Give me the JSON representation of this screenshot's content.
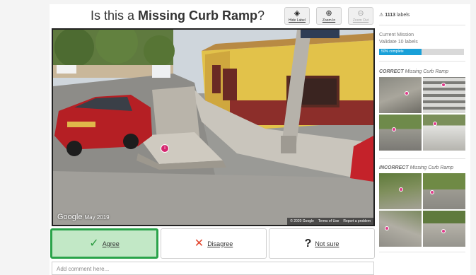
{
  "header": {
    "question_prefix": "Is this a ",
    "question_label": "Missing Curb Ramp",
    "question_suffix": "?"
  },
  "toolbar": {
    "hide_label": "Hide Label",
    "zoom_in": "Zoom In",
    "zoom_out": "Zoom Out"
  },
  "streetview": {
    "brand": "Google",
    "date": "May 2019",
    "copyright": "© 2020 Google",
    "terms": "Terms of Use",
    "report": "Report a problem",
    "sign_text": "AMBELES"
  },
  "votes": {
    "agree": "Agree",
    "disagree": "Disagree",
    "not_sure": "Not sure"
  },
  "comment": {
    "placeholder": "Add comment here..."
  },
  "sidebar": {
    "label_count": "1113",
    "label_count_suffix": " labels",
    "mission_title": "Current Mission",
    "mission_subtitle": "Validate 10 labels",
    "progress_text": "50% complete",
    "progress_fraction": 0.5,
    "correct_prefix": "CORRECT",
    "correct_title": " Missing Curb Ramp",
    "incorrect_prefix": "INCORRECT",
    "incorrect_title": " Missing Curb Ramp"
  },
  "colors": {
    "agree_bg": "#c2e8c6",
    "agree_border": "#2aa34a",
    "progress": "#19a0d8",
    "marker": "#d5256e",
    "disagree_icon": "#e2452d"
  }
}
